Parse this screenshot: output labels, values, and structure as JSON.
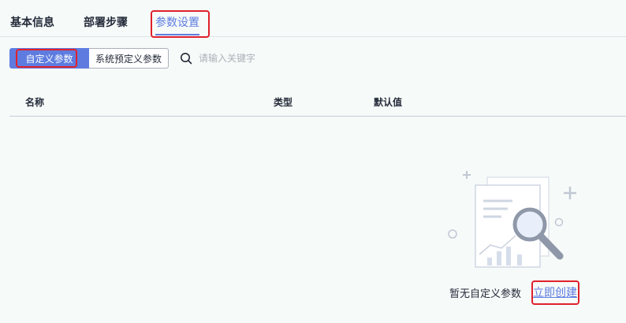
{
  "tabs": [
    {
      "label": "基本信息",
      "active": false
    },
    {
      "label": "部署步骤",
      "active": false
    },
    {
      "label": "参数设置",
      "active": true
    }
  ],
  "segmented": {
    "custom_label": "自定义参数",
    "system_label": "系统预定义参数",
    "selected": "自定义参数"
  },
  "search": {
    "placeholder": "请输入关键字",
    "value": "",
    "icon": "search-icon"
  },
  "table": {
    "headers": [
      "名称",
      "类型",
      "默认值"
    ],
    "rows": []
  },
  "empty_state": {
    "message": "暂无自定义参数",
    "create_link": "立即创建",
    "illustration": "magnifier-document-illustration"
  },
  "colors": {
    "accent": "#5e7ce0",
    "highlight_box": "#e0212b",
    "text": "#252b3a",
    "placeholder": "#adb0b8",
    "background": "#f6faf9"
  }
}
